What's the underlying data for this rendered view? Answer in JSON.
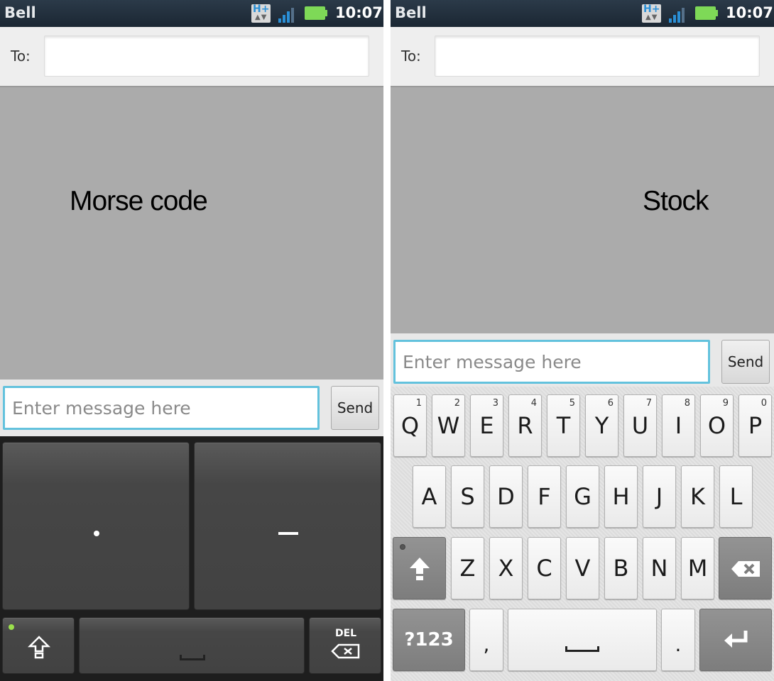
{
  "status_bar": {
    "carrier": "Bell",
    "network_badge": "H+",
    "time": "10:07"
  },
  "compose": {
    "to_label": "To:",
    "to_placeholder": "",
    "message_placeholder": "Enter message here",
    "send_label": "Send"
  },
  "left_panel": {
    "overlay_label": "Morse code",
    "keyboard": {
      "dot_key": "dot",
      "dash_key": "dash",
      "shift_key": "shift",
      "space_key": "space",
      "del_label": "DEL"
    }
  },
  "right_panel": {
    "overlay_label": "Stock",
    "keyboard": {
      "row1": [
        {
          "letter": "Q",
          "num": "1"
        },
        {
          "letter": "W",
          "num": "2"
        },
        {
          "letter": "E",
          "num": "3"
        },
        {
          "letter": "R",
          "num": "4"
        },
        {
          "letter": "T",
          "num": "5"
        },
        {
          "letter": "Y",
          "num": "6"
        },
        {
          "letter": "U",
          "num": "7"
        },
        {
          "letter": "I",
          "num": "8"
        },
        {
          "letter": "O",
          "num": "9"
        },
        {
          "letter": "P",
          "num": "0"
        }
      ],
      "row2": [
        "A",
        "S",
        "D",
        "F",
        "G",
        "H",
        "J",
        "K",
        "L"
      ],
      "row3": [
        "Z",
        "X",
        "C",
        "V",
        "B",
        "N",
        "M"
      ],
      "symbols_label": "?123",
      "comma": ",",
      "period": "."
    }
  },
  "colors": {
    "accent_focus": "#63c2dd",
    "battery": "#7ed957",
    "signal": "#2a8fd6",
    "led_on": "#9be04c"
  }
}
